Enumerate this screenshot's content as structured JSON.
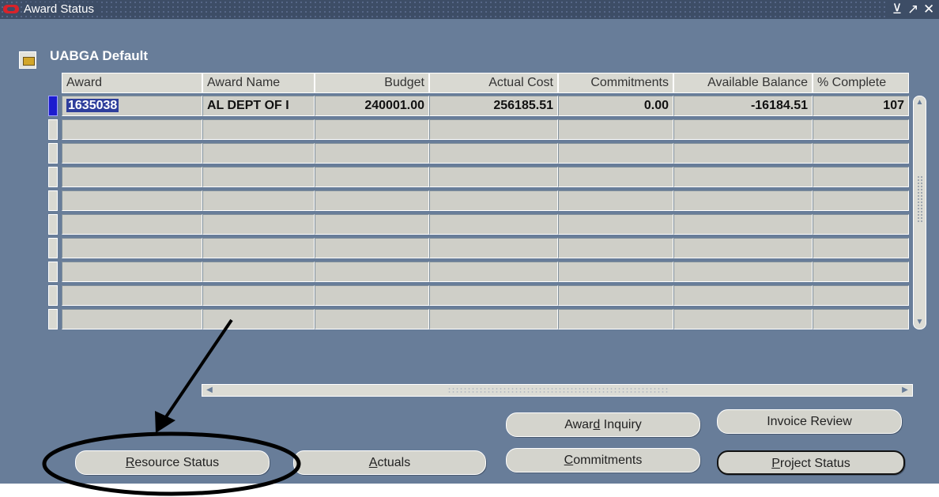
{
  "window": {
    "title": "Award Status",
    "controls": [
      "minimize-icon",
      "maximize-icon",
      "close-icon"
    ]
  },
  "form": {
    "title": "UABGA Default"
  },
  "table": {
    "columns": [
      "Award",
      "Award Name",
      "Budget",
      "Actual Cost",
      "Commitments",
      "Available Balance",
      "% Complete"
    ],
    "rows": [
      [
        "1635038",
        "AL DEPT OF I",
        "240001.00",
        "256185.51",
        "0.00",
        "-16184.51",
        "107"
      ],
      [
        "",
        "",
        "",
        "",
        "",
        "",
        ""
      ],
      [
        "",
        "",
        "",
        "",
        "",
        "",
        ""
      ],
      [
        "",
        "",
        "",
        "",
        "",
        "",
        ""
      ],
      [
        "",
        "",
        "",
        "",
        "",
        "",
        ""
      ],
      [
        "",
        "",
        "",
        "",
        "",
        "",
        ""
      ],
      [
        "",
        "",
        "",
        "",
        "",
        "",
        ""
      ],
      [
        "",
        "",
        "",
        "",
        "",
        "",
        ""
      ],
      [
        "",
        "",
        "",
        "",
        "",
        "",
        ""
      ],
      [
        "",
        "",
        "",
        "",
        "",
        "",
        ""
      ]
    ],
    "selected_row": 0
  },
  "buttons": {
    "award_inquiry": {
      "pre": "Awar",
      "key": "d",
      "post": " Inquiry"
    },
    "invoice_review": {
      "pre": "",
      "key": "",
      "post": "Invoice Review"
    },
    "resource_status": {
      "pre": "",
      "key": "R",
      "post": "esource Status"
    },
    "actuals": {
      "pre": "",
      "key": "A",
      "post": "ctuals"
    },
    "commitments": {
      "pre": "",
      "key": "C",
      "post": "ommitments"
    },
    "project_status": {
      "pre": "",
      "key": "P",
      "post": "roject Status"
    }
  },
  "annotation": {
    "color": "#000000",
    "target": "Resource Status"
  }
}
